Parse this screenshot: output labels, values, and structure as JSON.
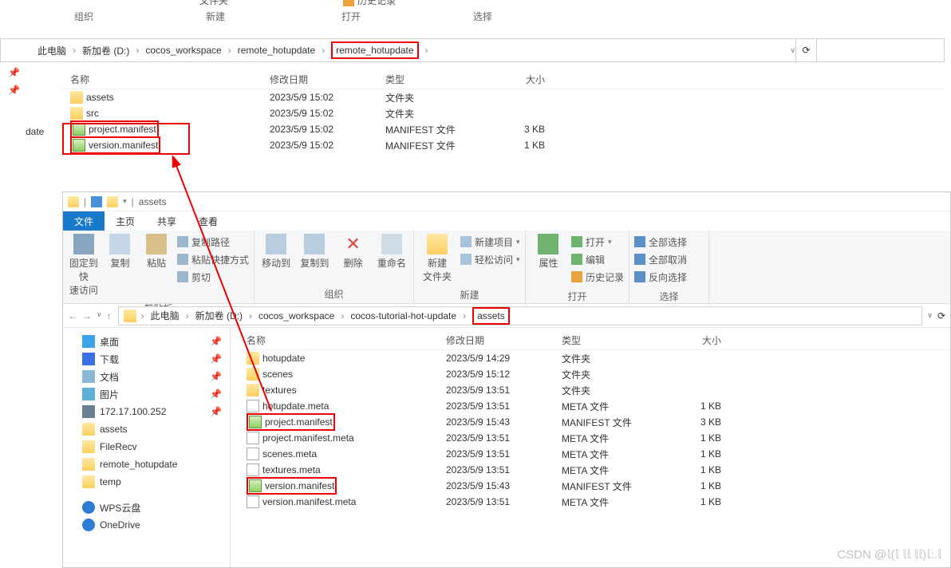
{
  "top_ribbon": {
    "org": "组织",
    "new": "新建",
    "open": "打开",
    "select": "选择",
    "folder_label": "文件夹",
    "history": "历史记录"
  },
  "win1": {
    "breadcrumb": [
      "此电脑",
      "新加卷 (D:)",
      "cocos_workspace",
      "remote_hotupdate",
      "remote_hotupdate"
    ],
    "sidebar_truncated": "date",
    "headers": {
      "name": "名称",
      "date": "修改日期",
      "type": "类型",
      "size": "大小"
    },
    "rows": [
      {
        "name": "assets",
        "date": "2023/5/9 15:02",
        "type": "文件夹",
        "size": "",
        "icon": "folder"
      },
      {
        "name": "src",
        "date": "2023/5/9 15:02",
        "type": "文件夹",
        "size": "",
        "icon": "folder"
      },
      {
        "name": "project.manifest",
        "date": "2023/5/9 15:02",
        "type": "MANIFEST 文件",
        "size": "3 KB",
        "icon": "manifest",
        "boxed": true
      },
      {
        "name": "version.manifest",
        "date": "2023/5/9 15:02",
        "type": "MANIFEST 文件",
        "size": "1 KB",
        "icon": "manifest",
        "boxed": true
      }
    ]
  },
  "win2": {
    "title_path": "assets",
    "tabs": {
      "file": "文件",
      "home": "主页",
      "share": "共享",
      "view": "查看"
    },
    "ribbon": {
      "pin": "固定到快\n速访问",
      "copy": "复制",
      "paste": "粘贴",
      "copy_path": "复制路径",
      "paste_shortcut": "粘贴快捷方式",
      "cut": "剪切",
      "clipboard": "剪贴板",
      "move_to": "移动到",
      "copy_to": "复制到",
      "delete": "删除",
      "rename": "重命名",
      "organize": "组织",
      "new_folder": "新建\n文件夹",
      "new_item": "新建项目",
      "easy_access": "轻松访问",
      "new": "新建",
      "properties": "属性",
      "open": "打开",
      "edit": "编辑",
      "history": "历史记录",
      "open_group": "打开",
      "select_all": "全部选择",
      "select_none": "全部取消",
      "invert": "反向选择",
      "select": "选择"
    },
    "breadcrumb": [
      "此电脑",
      "新加卷 (D:)",
      "cocos_workspace",
      "cocos-tutorial-hot-update",
      "assets"
    ],
    "sidebar": [
      {
        "label": "桌面",
        "ic": "desktop-ic",
        "pin": true
      },
      {
        "label": "下载",
        "ic": "dl-ic",
        "pin": true
      },
      {
        "label": "文档",
        "ic": "doc-ic",
        "pin": true
      },
      {
        "label": "图片",
        "ic": "pic-ic",
        "pin": true
      },
      {
        "label": "172.17.100.252",
        "ic": "net-ic",
        "pin": true
      },
      {
        "label": "assets",
        "ic": "folder-icon"
      },
      {
        "label": "FileRecv",
        "ic": "folder-icon"
      },
      {
        "label": "remote_hotupdate",
        "ic": "folder-icon"
      },
      {
        "label": "temp",
        "ic": "folder-icon"
      },
      {
        "label": "WPS云盘",
        "ic": "cloud-ic",
        "gap": true
      },
      {
        "label": "OneDrive",
        "ic": "cloud-ic"
      }
    ],
    "headers": {
      "name": "名称",
      "date": "修改日期",
      "type": "类型",
      "size": "大小"
    },
    "rows": [
      {
        "name": "hotupdate",
        "date": "2023/5/9 14:29",
        "type": "文件夹",
        "size": "",
        "icon": "folder"
      },
      {
        "name": "scenes",
        "date": "2023/5/9 15:12",
        "type": "文件夹",
        "size": "",
        "icon": "folder"
      },
      {
        "name": "textures",
        "date": "2023/5/9 13:51",
        "type": "文件夹",
        "size": "",
        "icon": "folder"
      },
      {
        "name": "hotupdate.meta",
        "date": "2023/5/9 13:51",
        "type": "META 文件",
        "size": "1 KB",
        "icon": "file"
      },
      {
        "name": "project.manifest",
        "date": "2023/5/9 15:43",
        "type": "MANIFEST 文件",
        "size": "3 KB",
        "icon": "manifest",
        "boxed": true
      },
      {
        "name": "project.manifest.meta",
        "date": "2023/5/9 13:51",
        "type": "META 文件",
        "size": "1 KB",
        "icon": "file"
      },
      {
        "name": "scenes.meta",
        "date": "2023/5/9 13:51",
        "type": "META 文件",
        "size": "1 KB",
        "icon": "file"
      },
      {
        "name": "textures.meta",
        "date": "2023/5/9 13:51",
        "type": "META 文件",
        "size": "1 KB",
        "icon": "file"
      },
      {
        "name": "version.manifest",
        "date": "2023/5/9 15:43",
        "type": "MANIFEST 文件",
        "size": "1 KB",
        "icon": "manifest",
        "boxed": true
      },
      {
        "name": "version.manifest.meta",
        "date": "2023/5/9 13:51",
        "type": "META 文件",
        "size": "1 KB",
        "icon": "file"
      }
    ]
  },
  "watermark": "CSDN @𝕝(𝕝 𝕝𝕝 𝕝𝕝)𝕝:.𝕝"
}
